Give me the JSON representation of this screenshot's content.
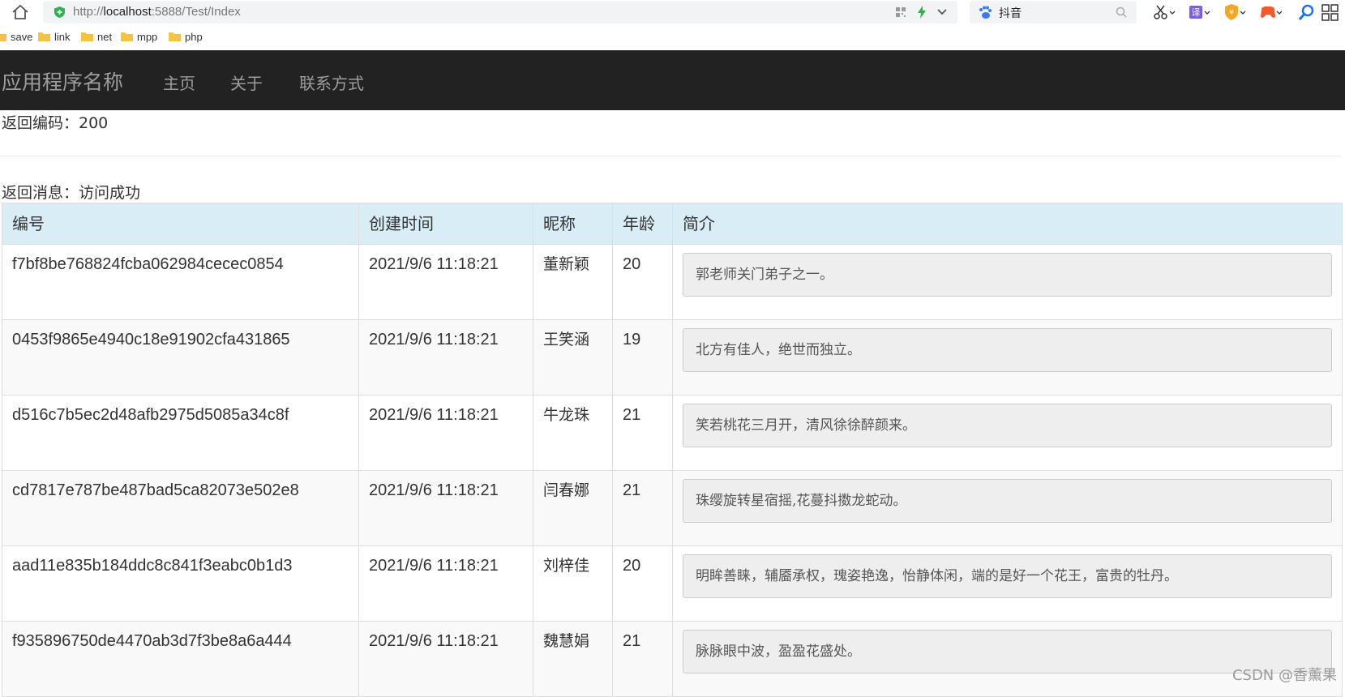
{
  "browser": {
    "url_prefix": "http://",
    "url_host": "localhost",
    "url_rest": ":5888/Test/Index",
    "search_text": "抖音",
    "bookmarks": [
      "save",
      "link",
      "net",
      "mpp",
      "php"
    ]
  },
  "app": {
    "brand": "应用程序名称",
    "nav": [
      "主页",
      "关于",
      "联系方式"
    ]
  },
  "result": {
    "code_line": "返回编码：200",
    "message_line": "返回消息：访问成功"
  },
  "table": {
    "headers": [
      "编号",
      "创建时间",
      "昵称",
      "年龄",
      "简介"
    ],
    "rows": [
      {
        "id": "f7bf8be768824fcba062984cecec0854",
        "time": "2021/9/6 11:18:21",
        "nick": "董新颖",
        "age": "20",
        "intro": "郭老师关门弟子之一。"
      },
      {
        "id": "0453f9865e4940c18e91902cfa431865",
        "time": "2021/9/6 11:18:21",
        "nick": "王笑涵",
        "age": "19",
        "intro": "北方有佳人，绝世而独立。"
      },
      {
        "id": "d516c7b5ec2d48afb2975d5085a34c8f",
        "time": "2021/9/6 11:18:21",
        "nick": "牛龙珠",
        "age": "21",
        "intro": "笑若桃花三月开，清风徐徐醉颜来。"
      },
      {
        "id": "cd7817e787be487bad5ca82073e502e8",
        "time": "2021/9/6 11:18:21",
        "nick": "闫春娜",
        "age": "21",
        "intro": "珠缨旋转星宿摇,花蔓抖擞龙蛇动。"
      },
      {
        "id": "aad11e835b184ddc8c841f3eabc0b1d3",
        "time": "2021/9/6 11:18:21",
        "nick": "刘梓佳",
        "age": "20",
        "intro": "明眸善睐，辅靥承权，瑰姿艳逸，怡静体闲，端的是好一个花王，富贵的牡丹。"
      },
      {
        "id": "f935896750de4470ab3d7f3be8a6a444",
        "time": "2021/9/6 11:18:21",
        "nick": "魏慧娟",
        "age": "21",
        "intro": "脉脉眼中波，盈盈花盛处。"
      }
    ]
  },
  "watermark": "CSDN @香薰果",
  "colors": {
    "navbar_bg": "#222222",
    "table_header_bg": "#d9edf7",
    "stripe_bg": "#f9f9f9"
  }
}
